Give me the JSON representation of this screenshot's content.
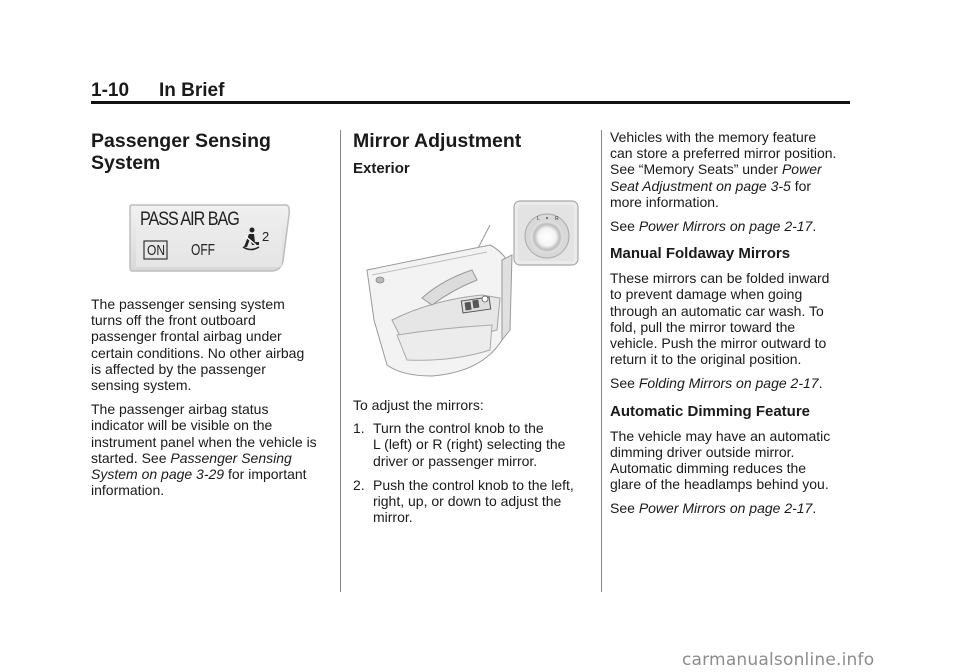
{
  "header": {
    "page_number": "1-10",
    "section_title": "In Brief"
  },
  "column1": {
    "heading_line1": "Passenger Sensing",
    "heading_line2": "System",
    "airbag_indicator": {
      "label": "PASS AIR BAG",
      "on_label": "ON",
      "off_label": "OFF",
      "icon": "seated-passenger-airbag-icon",
      "icon_suffix": "2"
    },
    "paragraph1": [
      "The passenger sensing system",
      "turns off the front outboard",
      "passenger frontal airbag under",
      "certain conditions. No other airbag",
      "is affected by the passenger",
      "sensing system."
    ],
    "paragraph2": {
      "lines_plain": [
        "The passenger airbag status",
        "indicator will be visible on the",
        "instrument panel when the vehicle is"
      ],
      "line4_prefix": "started. See ",
      "line4_ref": "Passenger Sensing",
      "line5_ref": "System on page 3-29",
      "line5_suffix": " for important",
      "line6": "information."
    }
  },
  "column2": {
    "heading": "Mirror Adjustment",
    "subheading": "Exterior",
    "illustration": {
      "description": "door-panel-mirror-control-illustration",
      "knob_labels": [
        "L",
        "R"
      ]
    },
    "intro": "To adjust the mirrors:",
    "steps": [
      {
        "num": "1.",
        "lines": [
          "Turn the control knob to the",
          "L (left) or R (right) selecting the",
          "driver or passenger mirror."
        ]
      },
      {
        "num": "2.",
        "lines": [
          "Push the control knob to the left,",
          "right, up, or down to adjust the",
          "mirror."
        ]
      }
    ]
  },
  "column3": {
    "paragraph1": {
      "lines_plain": [
        "Vehicles with the memory feature",
        "can store a preferred mirror position."
      ],
      "line3_prefix": "See “Memory Seats” under ",
      "line3_ref": "Power",
      "line4_ref": "Seat Adjustment on page 3-5",
      "line4_suffix": " for",
      "line5": "more information."
    },
    "see1_prefix": "See ",
    "see1_ref": "Power Mirrors on page 2-17",
    "see1_suffix": ".",
    "foldaway": {
      "heading": "Manual Foldaway Mirrors",
      "lines": [
        "These mirrors can be folded inward",
        "to prevent damage when going",
        "through an automatic car wash. To",
        "fold, pull the mirror toward the",
        "vehicle. Push the mirror outward to",
        "return it to the original position."
      ],
      "see_prefix": "See ",
      "see_ref": "Folding Mirrors on page 2-17",
      "see_suffix": "."
    },
    "dimming": {
      "heading": "Automatic Dimming Feature",
      "lines": [
        "The vehicle may have an automatic",
        "dimming driver outside mirror.",
        "Automatic dimming reduces the",
        "glare of the headlamps behind you."
      ],
      "see_prefix": "See ",
      "see_ref": "Power Mirrors on page 2-17",
      "see_suffix": "."
    }
  },
  "watermark": "carmanualsonline.info"
}
